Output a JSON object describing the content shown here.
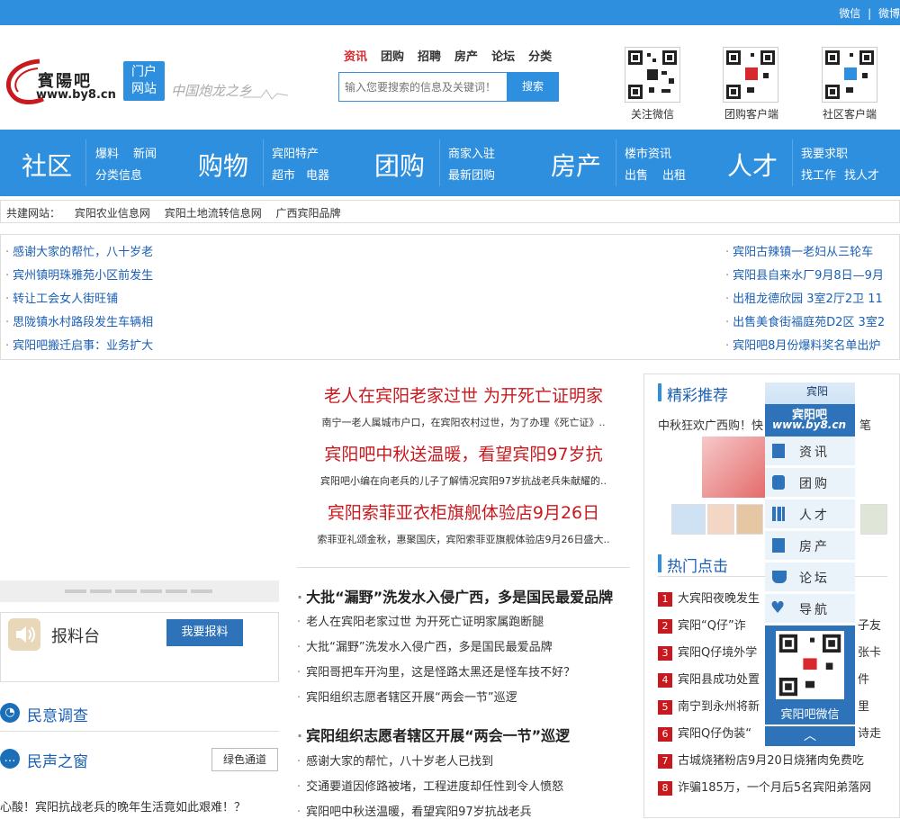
{
  "topbar": {
    "weixin": "微信",
    "sep": "|",
    "weibo": "微博"
  },
  "header": {
    "logo_name": "賓陽吧",
    "logo_url": "www.by8.cn",
    "portal_label_1": "门户",
    "portal_label_2": "网站",
    "slogan": "中国炮龙之乡",
    "search_tabs": [
      "资讯",
      "团购",
      "招聘",
      "房产",
      "论坛",
      "分类"
    ],
    "search_placeholder": "输入您要搜索的信息及关键词！",
    "search_button": "搜索",
    "qr": [
      {
        "caption": "关注微信"
      },
      {
        "caption": "团购客户端"
      },
      {
        "caption": "社区客户端"
      }
    ]
  },
  "nav": {
    "groups": [
      {
        "big": "社区",
        "small": [
          "爆料",
          "新闻",
          "分类信息"
        ]
      },
      {
        "big": "购物",
        "small": [
          "宾阳特产",
          "超市",
          "电器"
        ]
      },
      {
        "big": "团购",
        "small": [
          "商家入驻",
          "最新团购"
        ]
      },
      {
        "big": "房产",
        "small": [
          "楼市资讯",
          "出售",
          "出租"
        ]
      },
      {
        "big": "人才",
        "small": [
          "我要求职",
          "找工作",
          "找人才"
        ]
      }
    ]
  },
  "partners": {
    "label": "共建网站：",
    "items": [
      "宾阳农业信息网",
      "宾阳土地流转信息网",
      "广西宾阳品牌"
    ]
  },
  "ticker_left": [
    "感谢大家的帮忙，八十岁老",
    "宾州镇明珠雅苑小区前发生",
    "转让工会女人街旺铺",
    "思陇镇水村路段发生车辆相",
    "宾阳吧搬迁启事：业务扩大"
  ],
  "ticker_right": [
    "宾阳古辣镇一老妇从三轮车",
    "宾阳县自来水厂9月8日—9月",
    "出租龙德欣园 3室2厅2卫 11",
    "出售美食街福庭苑D2区 3室2",
    "宾阳吧8月份爆料奖名单出炉"
  ],
  "headlines": [
    {
      "title": "老人在宾阳老家过世 为开死亡证明家",
      "sub": "南宁一老人属城市户口，在宾阳农村过世，为了办理《死亡证》.."
    },
    {
      "title": "宾阳吧中秋送温暖，看望宾阳97岁抗",
      "sub": "宾阳吧小编在向老兵的儿子了解情况宾阳97岁抗战老兵朱献耀的.."
    },
    {
      "title": "宾阳索菲亚衣柜旗舰体验店9月26日",
      "sub": "索菲亚礼颂金秋，惠聚国庆，宾阳索菲亚旗舰体验店9月26日盛大.."
    }
  ],
  "left": {
    "baoliao_title": "报料台",
    "baoliao_button": "我要报料",
    "survey_title": "民意调查",
    "voice_title": "民声之窗",
    "green_channel": "绿色通道",
    "voice_item": "心酸！宾阳抗战老兵的晚年生活竟如此艰难！？"
  },
  "center_list_1": {
    "title": "大批“漏野”洗发水入侵广西，多是国民最爱品牌",
    "items": [
      "老人在宾阳老家过世 为开死亡证明家属跑断腿",
      "大批“漏野”洗发水入侵广西，多是国民最爱品牌",
      "宾阳哥把车开沟里，这是怪路太黑还是怪车技不好？",
      "宾阳组织志愿者辖区开展“两会一节”巡逻"
    ]
  },
  "center_list_2": {
    "title": "宾阳组织志愿者辖区开展“两会一节”巡逻",
    "items": [
      "感谢大家的帮忙，八十岁老人已找到",
      "交通要道因修路被堵，工程进度却任性到令人愤怒",
      "宾阳吧中秋送温暖，看望宾阳97岁抗战老兵"
    ]
  },
  "right": {
    "featured_title": "精彩推荐",
    "featured_text": "中秋狂欢广西购！快",
    "featured_tail": "笔",
    "hot_title": "热门点击",
    "hot_items": [
      "大宾阳夜晚发生",
      "宾阳“Q仔”诈",
      "宾阳Q仔境外学",
      "宾阳县成功处置",
      "南宁到永州将新",
      "宾阳Q仔伪装“",
      "古城烧猪粉店9月20日烧猪肉免费吃",
      "诈骗185万，一个月后5名宾阳弟落网"
    ],
    "hot_tails": [
      "",
      "子友",
      "张卡",
      "件",
      "里",
      "诗走",
      "",
      ""
    ]
  },
  "float": {
    "city": "宾阳",
    "brand": "宾阳吧",
    "url": "www.by8.cn",
    "items": [
      "资讯",
      "团购",
      "人才",
      "房产",
      "论坛",
      "导航"
    ],
    "qr_caption": "宾阳吧微信"
  },
  "colors": {
    "brand_blue": "#2e8fde",
    "headline_red": "#c8191e",
    "link_blue": "#1a5fb4"
  }
}
